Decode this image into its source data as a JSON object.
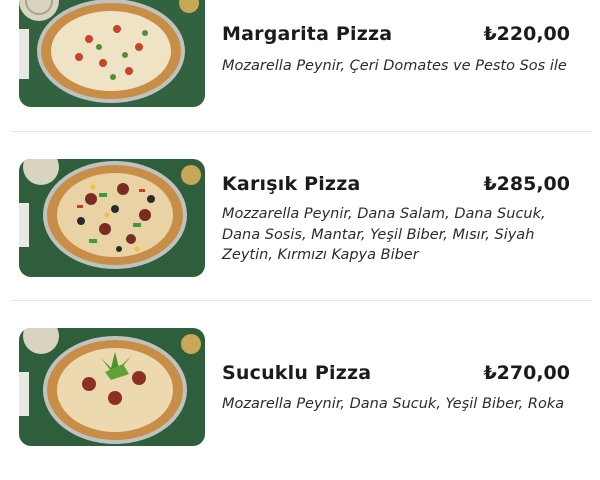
{
  "menu": {
    "items": [
      {
        "name": "Margarita Pizza",
        "price": "₺220,00",
        "description": "Mozarella Peynir, Çeri Domates ve Pesto Sos ile",
        "image_icon": "margarita-pizza-photo"
      },
      {
        "name": "Karışık Pizza",
        "price": "₺285,00",
        "description": "Mozzarella Peynir, Dana Salam, Dana Sucuk, Dana Sosis, Mantar, Yeşil Biber, Mısır, Siyah Zeytin, Kırmızı Kapya Biber",
        "image_icon": "mixed-pizza-photo"
      },
      {
        "name": "Sucuklu Pizza",
        "price": "₺270,00",
        "description": "Mozarella Peynir, Dana Sucuk, Yeşil Biber, Roka",
        "image_icon": "sucuk-pizza-photo"
      }
    ]
  },
  "colors": {
    "background": "#ffffff",
    "text": "#1b1b1b",
    "divider": "#e4e4e4",
    "photo_background": "#2f5e3c"
  }
}
